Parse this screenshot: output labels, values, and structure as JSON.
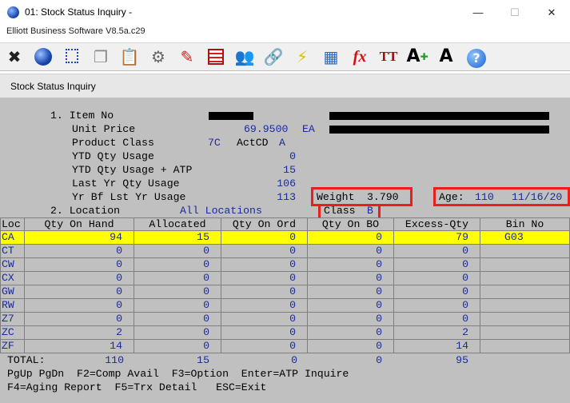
{
  "window": {
    "title": "01: Stock Status Inquiry -",
    "subtitle": "Elliott Business Software V8.5a.c29"
  },
  "toolbar": {
    "icons": [
      "close-x-icon",
      "globe-icon",
      "select-box-icon",
      "copy-icon",
      "paste-icon",
      "settings-icon",
      "edit-icon",
      "table-icon",
      "users-icon",
      "link-icon",
      "lightning-icon",
      "pad-icon",
      "function-icon",
      "font-icon",
      "font-larger-icon",
      "font-smaller-icon",
      "help-icon"
    ],
    "fx_label": "fx",
    "font_label": "TT",
    "font_up_label": "A",
    "font_down_label": "A",
    "help_label": "?"
  },
  "panel": {
    "title": "Stock Status Inquiry"
  },
  "item": {
    "field1_label": "1. Item No",
    "unit_price_label": "Unit Price",
    "unit_price": "69.9500",
    "uom": "EA",
    "product_class_label": "Product Class",
    "product_class": "7C",
    "actcd_label": "ActCD",
    "actcd": "A",
    "ytd_usage_label": "YTD Qty Usage",
    "ytd_usage": "0",
    "ytd_usage_atp_label": "YTD Qty Usage + ATP",
    "ytd_usage_atp": "15",
    "last_yr_usage_label": "Last Yr Qty Usage",
    "last_yr_usage": "106",
    "yr_bf_usage_label": "Yr Bf Lst Yr Usage",
    "yr_bf_usage": "113",
    "weight_label": "Weight",
    "weight": "3.790",
    "age_label": "Age:",
    "age": "110",
    "age_date": "11/16/20",
    "location_label": "2. Location",
    "location": "All Locations",
    "class_label": "Class",
    "class_value": "B"
  },
  "grid": {
    "headers": [
      "Loc",
      "Qty On Hand",
      "Allocated",
      "Qty On Ord",
      "Qty On BO",
      "Excess-Qty",
      "Bin No"
    ],
    "rows": [
      {
        "loc": "CA",
        "on_hand": "94",
        "allocated": "15",
        "on_ord": "0",
        "on_bo": "0",
        "excess": "79",
        "bin": "G03"
      },
      {
        "loc": "CT",
        "on_hand": "0",
        "allocated": "0",
        "on_ord": "0",
        "on_bo": "0",
        "excess": "0",
        "bin": ""
      },
      {
        "loc": "CW",
        "on_hand": "0",
        "allocated": "0",
        "on_ord": "0",
        "on_bo": "0",
        "excess": "0",
        "bin": ""
      },
      {
        "loc": "CX",
        "on_hand": "0",
        "allocated": "0",
        "on_ord": "0",
        "on_bo": "0",
        "excess": "0",
        "bin": ""
      },
      {
        "loc": "GW",
        "on_hand": "0",
        "allocated": "0",
        "on_ord": "0",
        "on_bo": "0",
        "excess": "0",
        "bin": ""
      },
      {
        "loc": "RW",
        "on_hand": "0",
        "allocated": "0",
        "on_ord": "0",
        "on_bo": "0",
        "excess": "0",
        "bin": ""
      },
      {
        "loc": "Z7",
        "on_hand": "0",
        "allocated": "0",
        "on_ord": "0",
        "on_bo": "0",
        "excess": "0",
        "bin": ""
      },
      {
        "loc": "ZC",
        "on_hand": "2",
        "allocated": "0",
        "on_ord": "0",
        "on_bo": "0",
        "excess": "2",
        "bin": ""
      },
      {
        "loc": "ZF",
        "on_hand": "14",
        "allocated": "0",
        "on_ord": "0",
        "on_bo": "0",
        "excess": "14",
        "bin": ""
      }
    ],
    "totals": {
      "label": "TOTAL:",
      "on_hand": "110",
      "allocated": "15",
      "on_ord": "0",
      "on_bo": "0",
      "excess": "95"
    }
  },
  "hints": {
    "line1": "PgUp PgDn  F2=Comp Avail  F3=Option  Enter=ATP Inquire",
    "line2": "F4=Aging Report  F5=Trx Detail   ESC=Exit"
  },
  "colors": {
    "value_blue": "#1a2a9a",
    "highlight_row": "#ffff00",
    "annotation_red": "#ee1c1c",
    "screen_bg": "#c0c0c0"
  }
}
